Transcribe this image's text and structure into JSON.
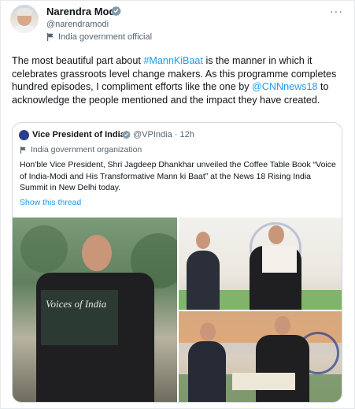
{
  "author": {
    "name": "Narendra Modi",
    "handle": "@narendramodi",
    "label": "India government official",
    "avatar_icon": "avatar-narendra-modi"
  },
  "tweet_text": {
    "part1": "The most beautiful part about ",
    "hashtag": "#MannKiBaat",
    "part2": " is the manner in which it celebrates grassroots level change makers. As this programme completes hundred episodes, I compliment efforts like the one by ",
    "mention": "@CNNnews18",
    "part3": " to acknowledge the people mentioned and the impact they have created."
  },
  "quoted": {
    "name": "Vice President of India",
    "handle": "@VPIndia · 12h",
    "label": "India government organization",
    "text": "Hon'ble Vice President, Shri Jagdeep Dhankhar unveiled the Coffee Table Book “Voice of India-Modi and His Transformative Mann ki Baat” at the News 18 Rising India Summit in New Delhi today.",
    "show_thread": "Show this thread",
    "book_title": "Voices of India"
  },
  "colors": {
    "link": "#1d9bf0",
    "verified": "#829aab",
    "muted": "#536471"
  }
}
